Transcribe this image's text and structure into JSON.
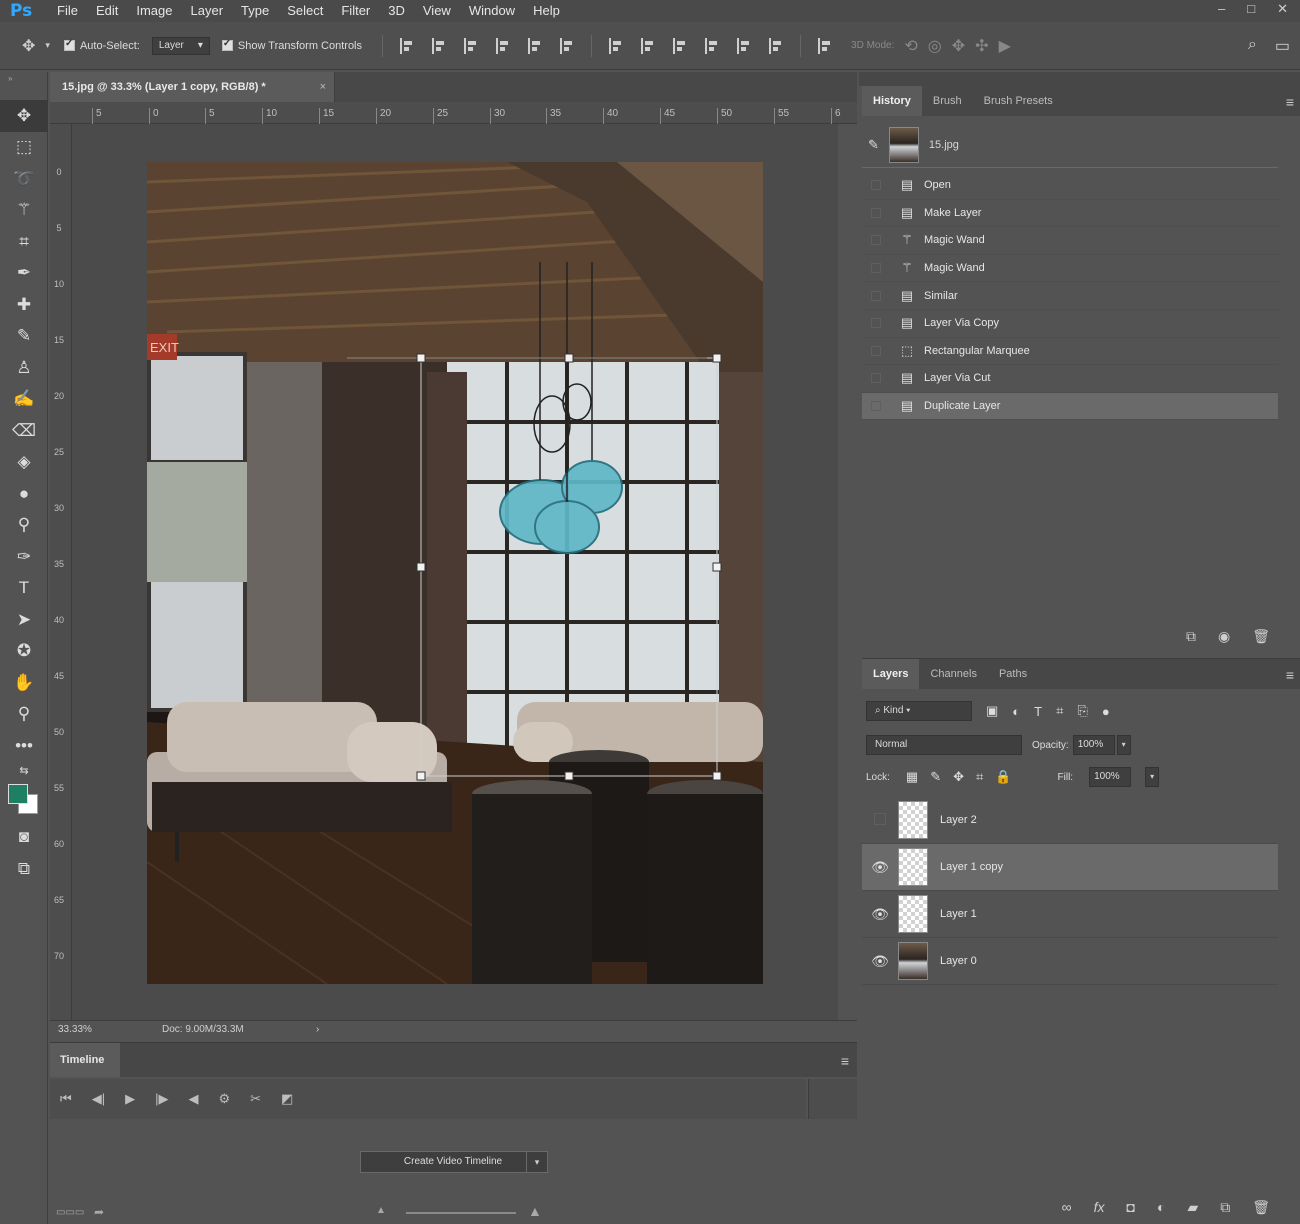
{
  "app": {
    "logo": "Ps"
  },
  "menu": [
    "File",
    "Edit",
    "Image",
    "Layer",
    "Type",
    "Select",
    "Filter",
    "3D",
    "View",
    "Window",
    "Help"
  ],
  "window_controls": [
    "–",
    "□",
    "✕"
  ],
  "options": {
    "auto_select_label": "Auto-Select:",
    "auto_select_target": "Layer",
    "show_transform_label": "Show Transform Controls",
    "mode_3d_label": "3D Mode:"
  },
  "document": {
    "tab_title": "15.jpg @ 33.3% (Layer 1 copy, RGB/8) *",
    "close": "×",
    "ruler_top": [
      "5",
      "0",
      "5",
      "10",
      "15",
      "20",
      "25",
      "30",
      "35",
      "40",
      "45",
      "50",
      "55",
      "6"
    ],
    "ruler_left": [
      "0",
      "5",
      "10",
      "15",
      "20",
      "25",
      "30",
      "35",
      "40",
      "45",
      "50",
      "55",
      "60",
      "65",
      "70"
    ],
    "zoom": "33.33%",
    "doc_size": "Doc: 9.00M/33.3M",
    "status_arrow": "›"
  },
  "photo_text": {
    "exit_sign": "EXIT"
  },
  "timeline": {
    "tab": "Timeline",
    "create_button": "Create Video Timeline",
    "controls": [
      "⏮",
      "◀|",
      "▶",
      "|▶",
      "◀",
      "⚙",
      "✂",
      "◩"
    ]
  },
  "history": {
    "tabs": [
      "History",
      "Brush",
      "Brush Presets"
    ],
    "snapshot": "15.jpg",
    "items": [
      {
        "label": "Open",
        "icon": "doc-icon"
      },
      {
        "label": "Make Layer",
        "icon": "doc-icon"
      },
      {
        "label": "Magic Wand",
        "icon": "magic-wand-icon"
      },
      {
        "label": "Magic Wand",
        "icon": "magic-wand-icon"
      },
      {
        "label": "Similar",
        "icon": "doc-icon"
      },
      {
        "label": "Layer Via Copy",
        "icon": "doc-icon"
      },
      {
        "label": "Rectangular Marquee",
        "icon": "marquee-icon"
      },
      {
        "label": "Layer Via Cut",
        "icon": "doc-icon"
      },
      {
        "label": "Duplicate Layer",
        "icon": "doc-icon"
      }
    ],
    "selected_index": 8
  },
  "layers": {
    "tabs": [
      "Layers",
      "Channels",
      "Paths"
    ],
    "filter": "Kind",
    "blend_mode": "Normal",
    "opacity_label": "Opacity:",
    "opacity": "100%",
    "lock_label": "Lock:",
    "fill_label": "Fill:",
    "fill": "100%",
    "items": [
      {
        "name": "Layer 2",
        "visible": false,
        "thumb": "transparent"
      },
      {
        "name": "Layer 1 copy",
        "visible": true,
        "thumb": "transparent",
        "selected": true
      },
      {
        "name": "Layer 1",
        "visible": true,
        "thumb": "transparent"
      },
      {
        "name": "Layer 0",
        "visible": true,
        "thumb": "photo"
      }
    ]
  },
  "colors": {
    "foreground": "#1e7f64",
    "background": "#ffffff",
    "accent": "#31a8ff"
  }
}
